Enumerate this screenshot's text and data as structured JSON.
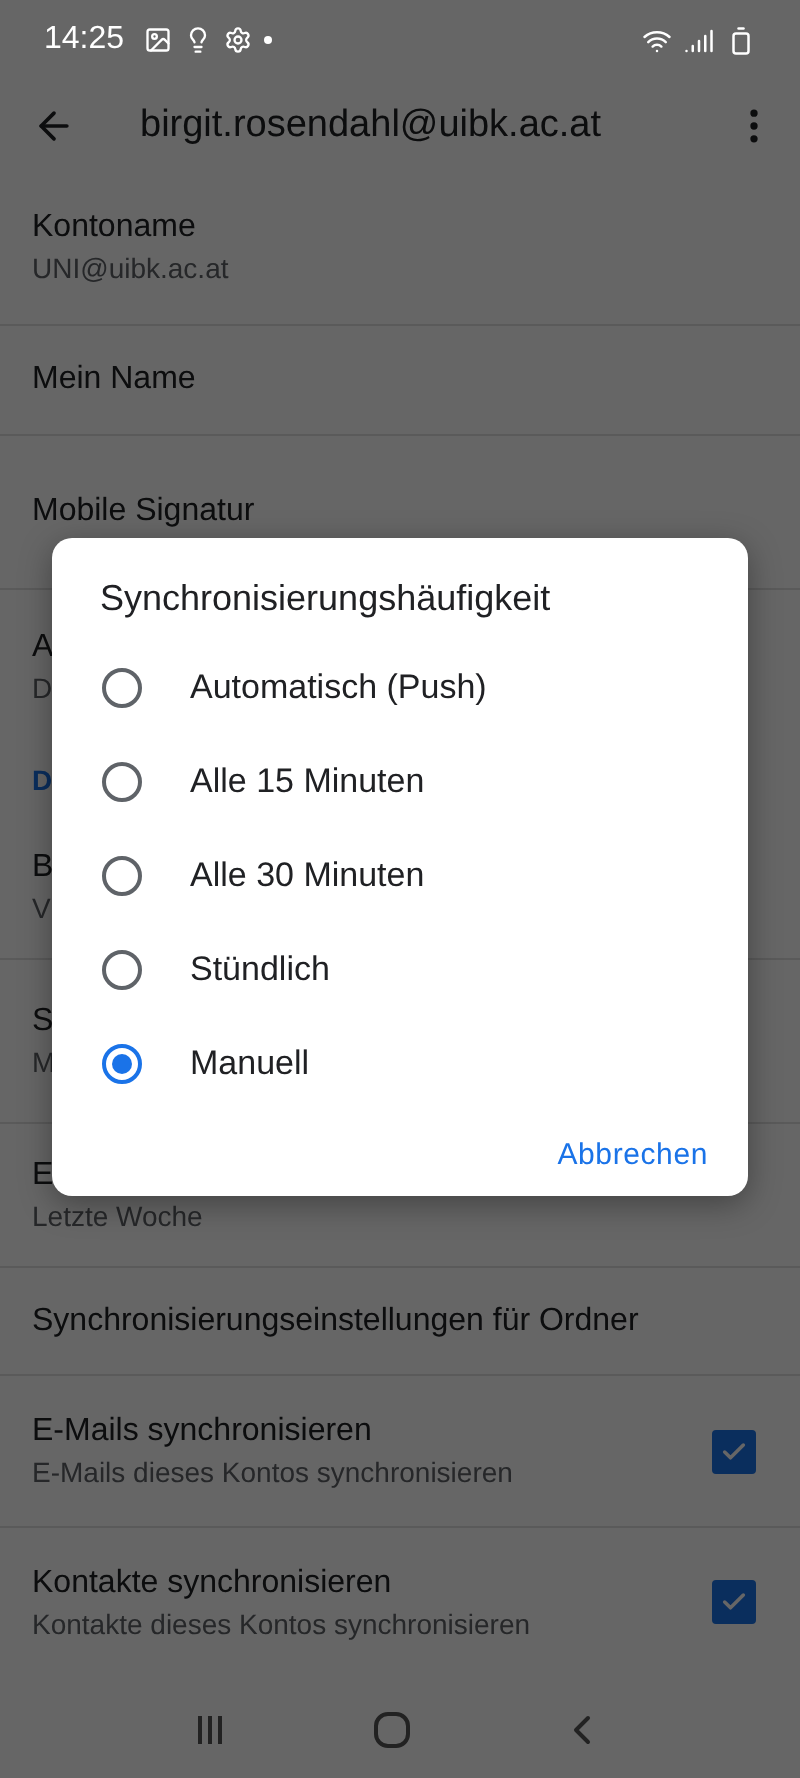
{
  "status_bar": {
    "time": "14:25"
  },
  "app_bar": {
    "title": "birgit.rosendahl@uibk.ac.at"
  },
  "settings": [
    {
      "kind": "item",
      "title": "Kontoname",
      "subtitle": "UNI@uibk.ac.at"
    },
    {
      "kind": "item",
      "title": "Mein Name"
    },
    {
      "kind": "item",
      "title": "Mobile Signatur"
    },
    {
      "kind": "item",
      "title": "A",
      "subtitle": "D"
    },
    {
      "kind": "header",
      "title": "D"
    },
    {
      "kind": "item",
      "title": "B",
      "subtitle": "V"
    },
    {
      "kind": "item",
      "title": "S",
      "subtitle": "M"
    },
    {
      "kind": "item",
      "title": "E",
      "subtitle": "Letzte Woche"
    },
    {
      "kind": "item",
      "title": "Synchronisierungseinstellungen für Ordner"
    },
    {
      "kind": "checkbox",
      "title": "E-Mails synchronisieren",
      "subtitle": "E-Mails dieses Kontos synchronisieren",
      "checked": true
    },
    {
      "kind": "checkbox",
      "title": "Kontakte synchronisieren",
      "subtitle": "Kontakte dieses Kontos synchronisieren",
      "checked": true
    }
  ],
  "dialog": {
    "title": "Synchronisierungshäufigkeit",
    "options": [
      {
        "label": "Automatisch (Push)",
        "selected": false
      },
      {
        "label": "Alle 15 Minuten",
        "selected": false
      },
      {
        "label": "Alle 30 Minuten",
        "selected": false
      },
      {
        "label": "Stündlich",
        "selected": false
      },
      {
        "label": "Manuell",
        "selected": true
      }
    ],
    "button": "Abbrechen"
  }
}
